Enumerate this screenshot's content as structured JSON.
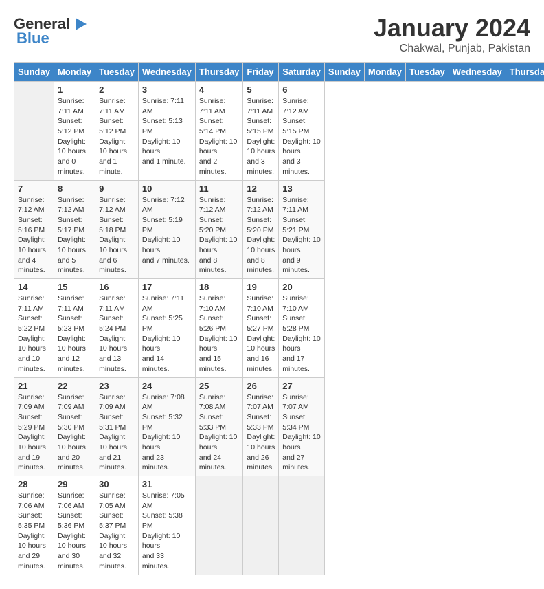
{
  "logo": {
    "line1": "General",
    "line2": "Blue"
  },
  "title": "January 2024",
  "location": "Chakwal, Punjab, Pakistan",
  "days_of_week": [
    "Sunday",
    "Monday",
    "Tuesday",
    "Wednesday",
    "Thursday",
    "Friday",
    "Saturday"
  ],
  "weeks": [
    [
      {
        "day": "",
        "info": ""
      },
      {
        "day": "1",
        "info": "Sunrise: 7:11 AM\nSunset: 5:12 PM\nDaylight: 10 hours\nand 0 minutes."
      },
      {
        "day": "2",
        "info": "Sunrise: 7:11 AM\nSunset: 5:12 PM\nDaylight: 10 hours\nand 1 minute."
      },
      {
        "day": "3",
        "info": "Sunrise: 7:11 AM\nSunset: 5:13 PM\nDaylight: 10 hours\nand 1 minute."
      },
      {
        "day": "4",
        "info": "Sunrise: 7:11 AM\nSunset: 5:14 PM\nDaylight: 10 hours\nand 2 minutes."
      },
      {
        "day": "5",
        "info": "Sunrise: 7:11 AM\nSunset: 5:15 PM\nDaylight: 10 hours\nand 3 minutes."
      },
      {
        "day": "6",
        "info": "Sunrise: 7:12 AM\nSunset: 5:15 PM\nDaylight: 10 hours\nand 3 minutes."
      }
    ],
    [
      {
        "day": "7",
        "info": "Sunrise: 7:12 AM\nSunset: 5:16 PM\nDaylight: 10 hours\nand 4 minutes."
      },
      {
        "day": "8",
        "info": "Sunrise: 7:12 AM\nSunset: 5:17 PM\nDaylight: 10 hours\nand 5 minutes."
      },
      {
        "day": "9",
        "info": "Sunrise: 7:12 AM\nSunset: 5:18 PM\nDaylight: 10 hours\nand 6 minutes."
      },
      {
        "day": "10",
        "info": "Sunrise: 7:12 AM\nSunset: 5:19 PM\nDaylight: 10 hours\nand 7 minutes."
      },
      {
        "day": "11",
        "info": "Sunrise: 7:12 AM\nSunset: 5:20 PM\nDaylight: 10 hours\nand 8 minutes."
      },
      {
        "day": "12",
        "info": "Sunrise: 7:12 AM\nSunset: 5:20 PM\nDaylight: 10 hours\nand 8 minutes."
      },
      {
        "day": "13",
        "info": "Sunrise: 7:11 AM\nSunset: 5:21 PM\nDaylight: 10 hours\nand 9 minutes."
      }
    ],
    [
      {
        "day": "14",
        "info": "Sunrise: 7:11 AM\nSunset: 5:22 PM\nDaylight: 10 hours\nand 10 minutes."
      },
      {
        "day": "15",
        "info": "Sunrise: 7:11 AM\nSunset: 5:23 PM\nDaylight: 10 hours\nand 12 minutes."
      },
      {
        "day": "16",
        "info": "Sunrise: 7:11 AM\nSunset: 5:24 PM\nDaylight: 10 hours\nand 13 minutes."
      },
      {
        "day": "17",
        "info": "Sunrise: 7:11 AM\nSunset: 5:25 PM\nDaylight: 10 hours\nand 14 minutes."
      },
      {
        "day": "18",
        "info": "Sunrise: 7:10 AM\nSunset: 5:26 PM\nDaylight: 10 hours\nand 15 minutes."
      },
      {
        "day": "19",
        "info": "Sunrise: 7:10 AM\nSunset: 5:27 PM\nDaylight: 10 hours\nand 16 minutes."
      },
      {
        "day": "20",
        "info": "Sunrise: 7:10 AM\nSunset: 5:28 PM\nDaylight: 10 hours\nand 17 minutes."
      }
    ],
    [
      {
        "day": "21",
        "info": "Sunrise: 7:09 AM\nSunset: 5:29 PM\nDaylight: 10 hours\nand 19 minutes."
      },
      {
        "day": "22",
        "info": "Sunrise: 7:09 AM\nSunset: 5:30 PM\nDaylight: 10 hours\nand 20 minutes."
      },
      {
        "day": "23",
        "info": "Sunrise: 7:09 AM\nSunset: 5:31 PM\nDaylight: 10 hours\nand 21 minutes."
      },
      {
        "day": "24",
        "info": "Sunrise: 7:08 AM\nSunset: 5:32 PM\nDaylight: 10 hours\nand 23 minutes."
      },
      {
        "day": "25",
        "info": "Sunrise: 7:08 AM\nSunset: 5:33 PM\nDaylight: 10 hours\nand 24 minutes."
      },
      {
        "day": "26",
        "info": "Sunrise: 7:07 AM\nSunset: 5:33 PM\nDaylight: 10 hours\nand 26 minutes."
      },
      {
        "day": "27",
        "info": "Sunrise: 7:07 AM\nSunset: 5:34 PM\nDaylight: 10 hours\nand 27 minutes."
      }
    ],
    [
      {
        "day": "28",
        "info": "Sunrise: 7:06 AM\nSunset: 5:35 PM\nDaylight: 10 hours\nand 29 minutes."
      },
      {
        "day": "29",
        "info": "Sunrise: 7:06 AM\nSunset: 5:36 PM\nDaylight: 10 hours\nand 30 minutes."
      },
      {
        "day": "30",
        "info": "Sunrise: 7:05 AM\nSunset: 5:37 PM\nDaylight: 10 hours\nand 32 minutes."
      },
      {
        "day": "31",
        "info": "Sunrise: 7:05 AM\nSunset: 5:38 PM\nDaylight: 10 hours\nand 33 minutes."
      },
      {
        "day": "",
        "info": ""
      },
      {
        "day": "",
        "info": ""
      },
      {
        "day": "",
        "info": ""
      }
    ]
  ]
}
